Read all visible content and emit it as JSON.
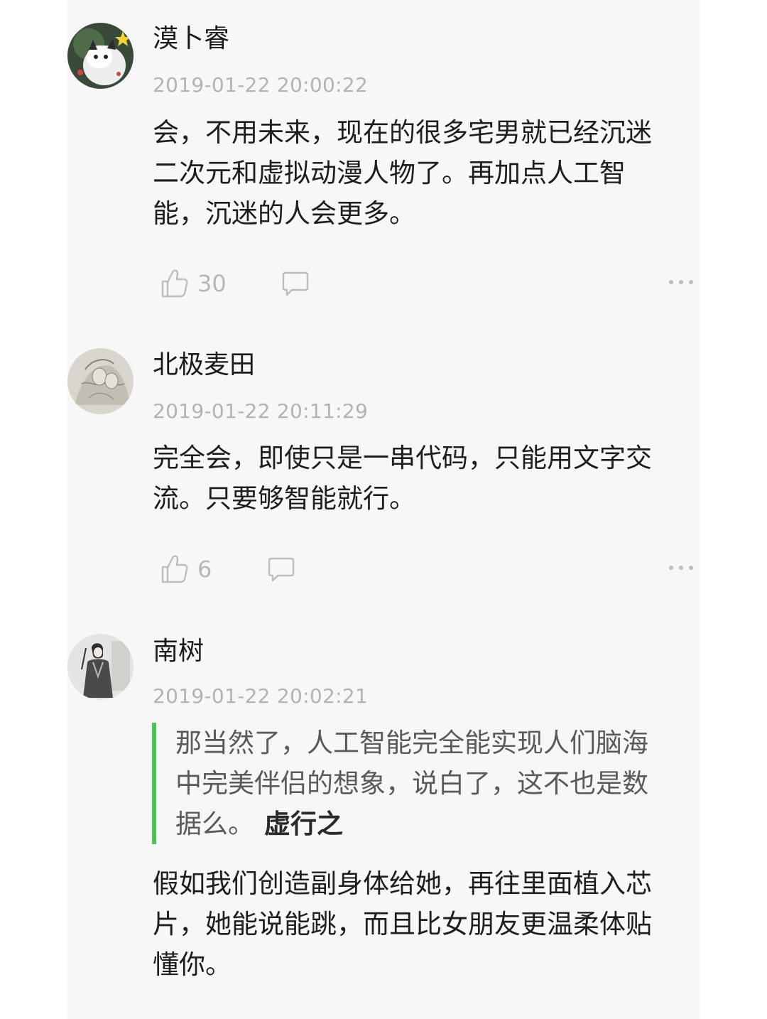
{
  "comments": [
    {
      "username": "漠卜睿",
      "timestamp": "2019-01-22 20:00:22",
      "content_lines": [
        "会，不用未来，现在的很多宅男就已经沉迷",
        "二次元和虚拟动漫人物了。再加点人工智",
        "能，沉迷的人会更多。"
      ],
      "likes": "30",
      "avatar_icon": "cat-avatar-icon"
    },
    {
      "username": "北极麦田",
      "timestamp": "2019-01-22 20:11:29",
      "content_lines": [
        "完全会，即使只是一串代码，只能用文字交",
        "流。只要够智能就行。"
      ],
      "likes": "6",
      "avatar_icon": "sketch-avatar-icon"
    },
    {
      "username": "南树",
      "timestamp": "2019-01-22 20:02:21",
      "quote": {
        "lines": [
          "那当然了，人工智能完全能实现人们脑海",
          "中完美伴侣的想象，说白了，这不也是数",
          "据么。"
        ],
        "author": "虚行之"
      },
      "content_lines": [
        "假如我们创造副身体给她，再往里面植入芯",
        "片，她能说能跳，而且比女朋友更温柔体贴",
        "懂你。"
      ],
      "avatar_icon": "illustration-avatar-icon"
    }
  ],
  "icons": {
    "like": "thumbs-up-icon",
    "reply": "speech-bubble-icon",
    "more": "more-dots-icon"
  },
  "colors": {
    "background": "#ffffff",
    "panel": "#f7f7f7",
    "quote_bar": "#4cc35a",
    "muted_text": "#b3b3b3"
  }
}
